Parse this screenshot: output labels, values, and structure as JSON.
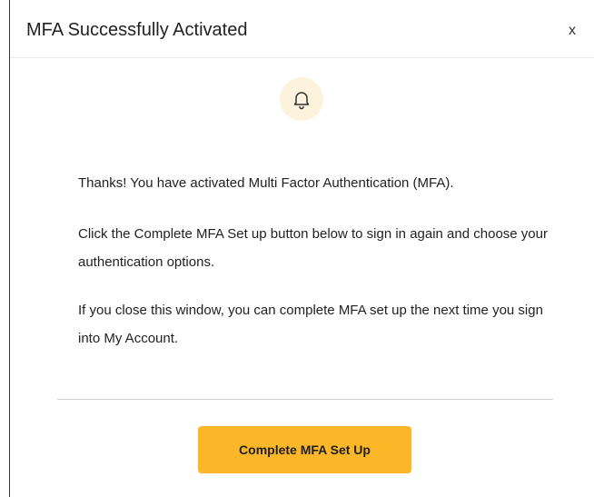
{
  "dialog": {
    "title": "MFA Successfully Activated",
    "close_label": "x",
    "icon": "bell-icon",
    "paragraphs": [
      "Thanks! You have activated Multi Factor Authentication (MFA).",
      "Click the Complete MFA Set up button below to sign in again and choose your authentication options.",
      "If you close this window, you can complete MFA set up the next time you sign into My Account."
    ],
    "primary_button_label": "Complete MFA Set Up"
  },
  "colors": {
    "accent": "#fbb728",
    "icon_background": "#fdf3dc",
    "text": "#222222"
  }
}
